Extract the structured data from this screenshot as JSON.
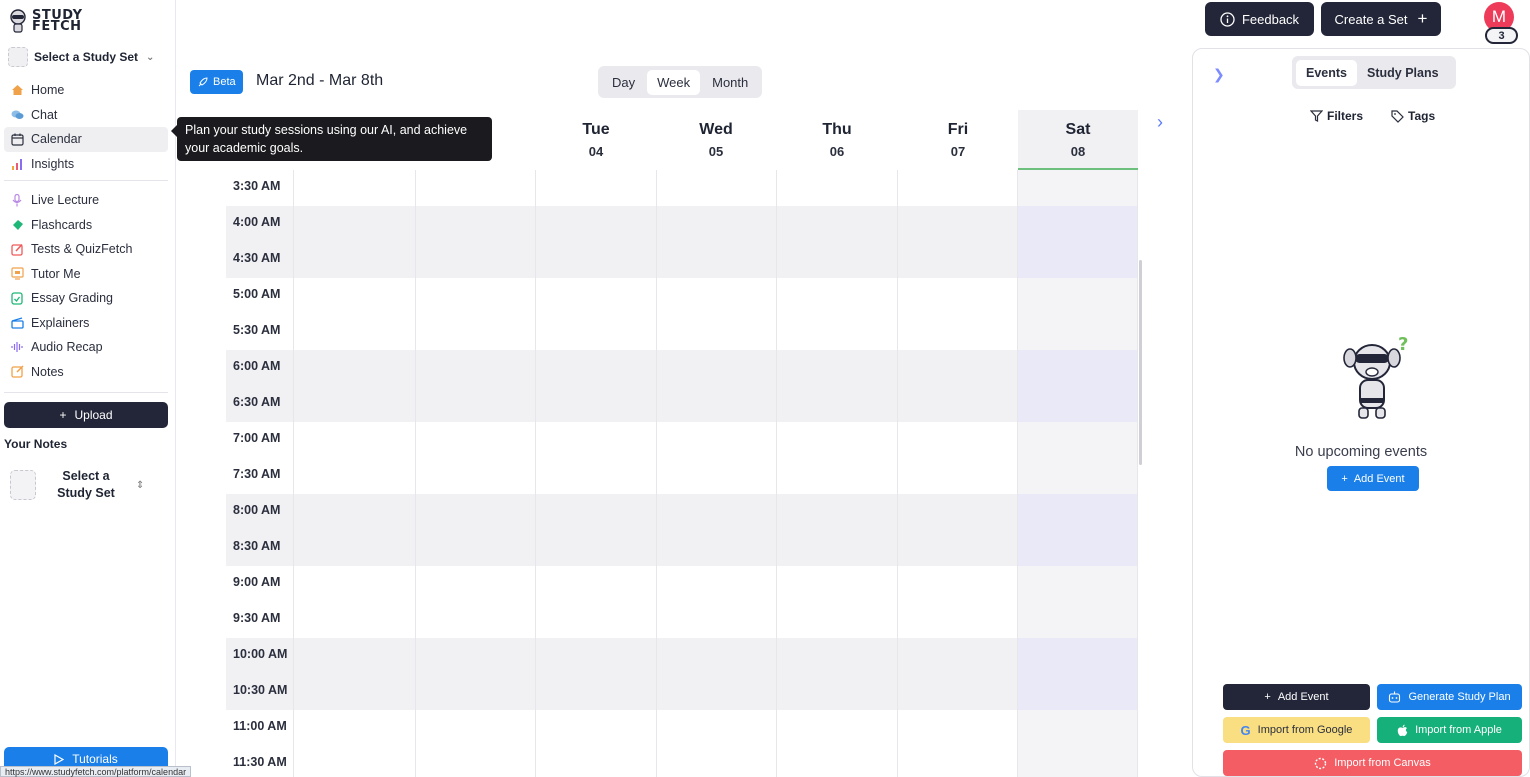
{
  "brand": {
    "logo_text_line1": "STUDY",
    "logo_text_line2": "FETCH"
  },
  "sidebar": {
    "study_set_label": "Select a Study Set",
    "nav_items": [
      {
        "label": "Home",
        "icon": "home-icon",
        "color": "#f0a24b"
      },
      {
        "label": "Chat",
        "icon": "chat-icon",
        "color": "#6aa7d8"
      },
      {
        "label": "Calendar",
        "icon": "calendar-icon",
        "color": "#2b2f3d"
      },
      {
        "label": "Insights",
        "icon": "insights-icon",
        "color": "#e85d75"
      },
      {
        "label": "Live Lecture",
        "icon": "microphone-icon",
        "color": "#b98ae3"
      },
      {
        "label": "Flashcards",
        "icon": "flashcards-icon",
        "color": "#1fb777"
      },
      {
        "label": "Tests & QuizFetch",
        "icon": "quiz-icon",
        "color": "#ef5a5a"
      },
      {
        "label": "Tutor Me",
        "icon": "tutor-icon",
        "color": "#f0a24b"
      },
      {
        "label": "Essay Grading",
        "icon": "essay-icon",
        "color": "#1fb777"
      },
      {
        "label": "Explainers",
        "icon": "explainers-icon",
        "color": "#1a7fe8"
      },
      {
        "label": "Audio Recap",
        "icon": "audio-icon",
        "color": "#8a6cf0"
      },
      {
        "label": "Notes",
        "icon": "notes-icon",
        "color": "#f0a24b"
      }
    ],
    "upload_label": "Upload",
    "your_notes_label": "Your Notes",
    "note_select_label": "Select a Study Set",
    "tutorials_label": "Tutorials",
    "status_url": "https://www.studyfetch.com/platform/calendar"
  },
  "tooltip": {
    "text": "Plan your study sessions using our AI, and achieve your academic goals."
  },
  "header": {
    "beta_label": "Beta",
    "date_range": "Mar 2nd - Mar 8th",
    "views": [
      "Day",
      "Week",
      "Month"
    ],
    "active_view": "Week"
  },
  "calendar": {
    "days": [
      {
        "dow": "Tue",
        "dom": "04"
      },
      {
        "dow": "Wed",
        "dom": "05"
      },
      {
        "dow": "Thu",
        "dom": "06"
      },
      {
        "dow": "Fri",
        "dom": "07"
      },
      {
        "dow": "Sat",
        "dom": "08",
        "selected": true
      }
    ],
    "times": [
      "3:30 AM",
      "4:00 AM",
      "4:30 AM",
      "5:00 AM",
      "5:30 AM",
      "6:00 AM",
      "6:30 AM",
      "7:00 AM",
      "7:30 AM",
      "8:00 AM",
      "8:30 AM",
      "9:00 AM",
      "9:30 AM",
      "10:00 AM",
      "10:30 AM",
      "11:00 AM",
      "11:30 AM"
    ]
  },
  "topbar": {
    "feedback_label": "Feedback",
    "create_set_label": "Create a Set",
    "avatar_initial": "M",
    "avatar_badge": "3",
    "avatar_color": "#ee3b5a"
  },
  "panel": {
    "tabs": [
      "Events",
      "Study Plans"
    ],
    "active_tab": "Events",
    "filters_label": "Filters",
    "tags_label": "Tags",
    "empty_text": "No upcoming events",
    "add_event_small_label": "Add Event",
    "buttons": {
      "add_event": "Add Event",
      "generate_plan": "Generate Study Plan",
      "import_google": "Import from Google",
      "import_apple": "Import from Apple",
      "import_canvas": "Import from Canvas"
    }
  },
  "colors": {
    "accent": "#1a7fe8",
    "dark": "#232638",
    "selected_day_line": "#6cbf7c"
  }
}
